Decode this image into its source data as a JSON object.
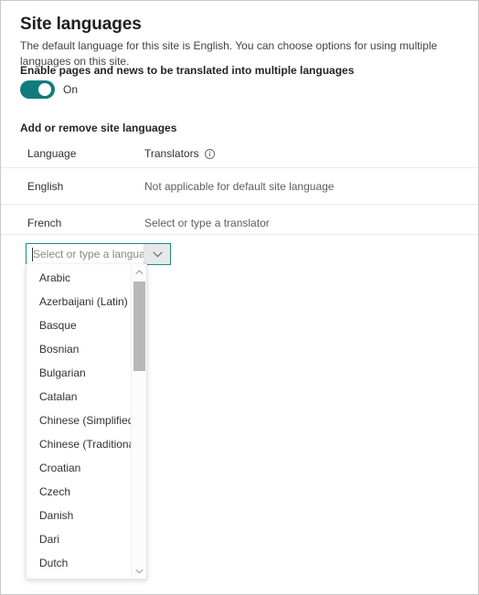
{
  "panel": {
    "title": "Site languages",
    "description": "The default language for this site is English. You can choose options for using multiple languages on this site."
  },
  "translation_toggle": {
    "label": "Enable pages and news to be translated into multiple languages",
    "state_text": "On",
    "checked": true,
    "accent_color": "#0f7c7b"
  },
  "languages_section": {
    "title": "Add or remove site languages",
    "columns": {
      "language": "Language",
      "translators": "Translators",
      "translators_info_icon": "info-icon"
    },
    "rows": [
      {
        "language": "English",
        "translator": "Not applicable for default site language"
      },
      {
        "language": "French",
        "translator": "Select or type a translator"
      }
    ]
  },
  "language_picker": {
    "value": "",
    "placeholder": "Select or type a language",
    "expand_icon": "chevron-down-icon",
    "focus_border_color": "#1b8a8a",
    "options": [
      "Arabic",
      "Azerbaijani (Latin)",
      "Basque",
      "Bosnian",
      "Bulgarian",
      "Catalan",
      "Chinese (Simplified)",
      "Chinese (Traditional, Tai...",
      "Croatian",
      "Czech",
      "Danish",
      "Dari",
      "Dutch"
    ],
    "scrollbar": {
      "up_icon": "chevron-up-icon",
      "down_icon": "chevron-down-icon"
    }
  }
}
